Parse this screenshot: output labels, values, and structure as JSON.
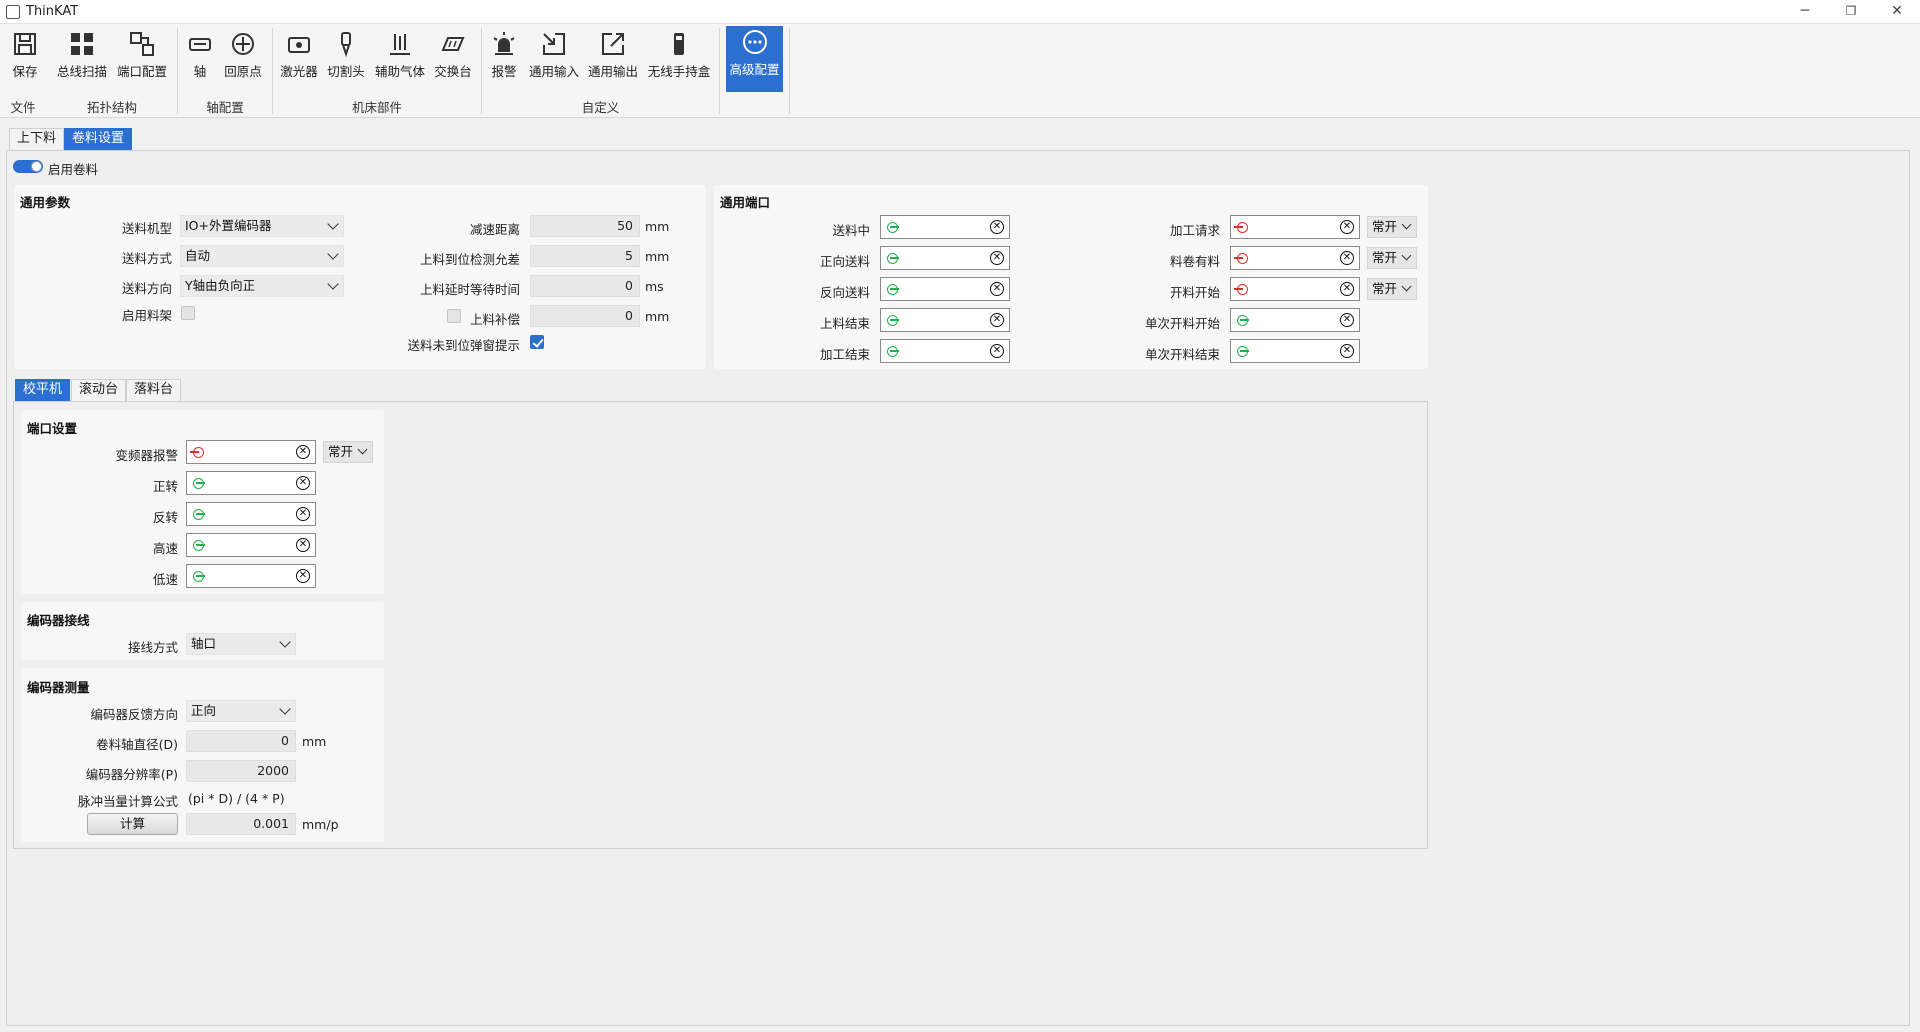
{
  "window": {
    "title": "ThinKAT",
    "minimize": "─",
    "maximize": "❐",
    "close": "✕"
  },
  "ribbon": {
    "buttons": [
      {
        "label": "保存",
        "icon": "save-icon"
      },
      {
        "label": "总线扫描",
        "icon": "bus-scan-icon"
      },
      {
        "label": "端口配置",
        "icon": "port-config-icon"
      },
      {
        "label": "轴",
        "icon": "axis-icon"
      },
      {
        "label": "回原点",
        "icon": "home-origin-icon"
      },
      {
        "label": "激光器",
        "icon": "laser-icon"
      },
      {
        "label": "切割头",
        "icon": "cutting-head-icon"
      },
      {
        "label": "辅助气体",
        "icon": "assist-gas-icon"
      },
      {
        "label": "交换台",
        "icon": "exchange-table-icon"
      },
      {
        "label": "报警",
        "icon": "alarm-icon"
      },
      {
        "label": "通用输入",
        "icon": "general-input-icon"
      },
      {
        "label": "通用输出",
        "icon": "general-output-icon"
      },
      {
        "label": "无线手持盒",
        "icon": "wireless-handheld-icon"
      },
      {
        "label": "高级配置",
        "icon": "advanced-config-icon"
      }
    ],
    "groups": [
      "文件",
      "拓扑结构",
      "轴配置",
      "机床部件",
      "自定义"
    ]
  },
  "tabs": [
    "上下料",
    "卷料设置"
  ],
  "enable_coil": {
    "label": "启用卷料"
  },
  "general_params": {
    "title": "通用参数",
    "feed_type": {
      "label": "送料机型",
      "value": "IO+外置编码器"
    },
    "feed_mode": {
      "label": "送料方式",
      "value": "自动"
    },
    "feed_direction": {
      "label": "送料方向",
      "value": "Y轴由负向正"
    },
    "enable_rack": {
      "label": "启用料架"
    },
    "decel_distance": {
      "label": "减速距离",
      "value": "50",
      "unit": "mm"
    },
    "detect_tolerance": {
      "label": "上料到位检测允差",
      "value": "5",
      "unit": "mm"
    },
    "delay_wait": {
      "label": "上料延时等待时间",
      "value": "0",
      "unit": "ms"
    },
    "compensation": {
      "label": "上料补偿",
      "value": "0",
      "unit": "mm"
    },
    "popup_hint": {
      "label": "送料未到位弹窗提示"
    }
  },
  "general_ports": {
    "title": "通用端口",
    "left": [
      "送料中",
      "正向送料",
      "反向送料",
      "上料结束",
      "加工结束"
    ],
    "right": [
      "加工请求",
      "料卷有料",
      "开料开始",
      "单次开料开始",
      "单次开料结束"
    ],
    "mode_value": "常开"
  },
  "sub_tabs": [
    "校平机",
    "滚动台",
    "落料台"
  ],
  "port_settings": {
    "title": "端口设置",
    "items": [
      "变频器报警",
      "正转",
      "反转",
      "高速",
      "低速"
    ],
    "mode_value": "常开"
  },
  "encoder_wiring": {
    "title": "编码器接线",
    "label": "接线方式",
    "value": "轴口"
  },
  "encoder_measure": {
    "title": "编码器测量",
    "feedback_dir": {
      "label": "编码器反馈方向",
      "value": "正向"
    },
    "shaft_diameter": {
      "label": "卷料轴直径(D)",
      "value": "0",
      "unit": "mm"
    },
    "resolution": {
      "label": "编码器分辨率(P)",
      "value": "2000"
    },
    "formula": {
      "label": "脉冲当量计算公式",
      "value": "(pi * D) / (4 * P)"
    },
    "calc_button": "计算",
    "result": {
      "value": "0.001",
      "unit": "mm/p"
    }
  }
}
